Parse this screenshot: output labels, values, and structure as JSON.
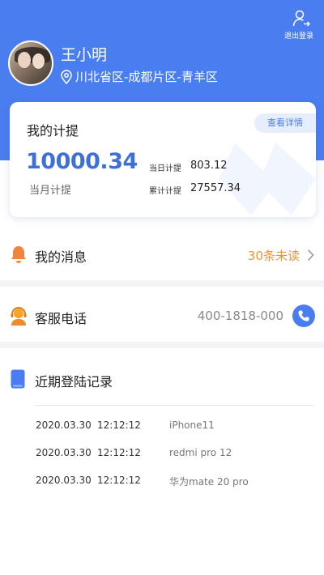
{
  "header": {
    "logout_label": "退出登录",
    "user_name": "王小明",
    "region": "川北省区-成都片区-青羊区"
  },
  "card": {
    "title": "我的计提",
    "detail_button": "查看详情",
    "month_amount": "10000.34",
    "month_label": "当月计提",
    "today_label": "当日计提",
    "today_value": "803.12",
    "total_label": "累计计提",
    "total_value": "27557.34"
  },
  "messages": {
    "label": "我的消息",
    "unread": "30条未读"
  },
  "service": {
    "label": "客服电话",
    "phone": "400-1818-000"
  },
  "login_log": {
    "label": "近期登陆记录",
    "rows": [
      {
        "date": "2020.03.30",
        "time": "12:12:12",
        "device": "iPhone11"
      },
      {
        "date": "2020.03.30",
        "time": "12:12:12",
        "device": "redmi pro 12"
      },
      {
        "date": "2020.03.30",
        "time": "12:12:12",
        "device": "华为mate 20 pro"
      }
    ]
  },
  "colors": {
    "brand": "#4a7ef0",
    "accent": "#f0932f",
    "amount": "#3f70d8"
  },
  "icons": [
    "logout-icon",
    "location-pin-icon",
    "bell-icon",
    "customer-service-icon",
    "phone-icon",
    "device-icon",
    "chevron-right-icon"
  ]
}
